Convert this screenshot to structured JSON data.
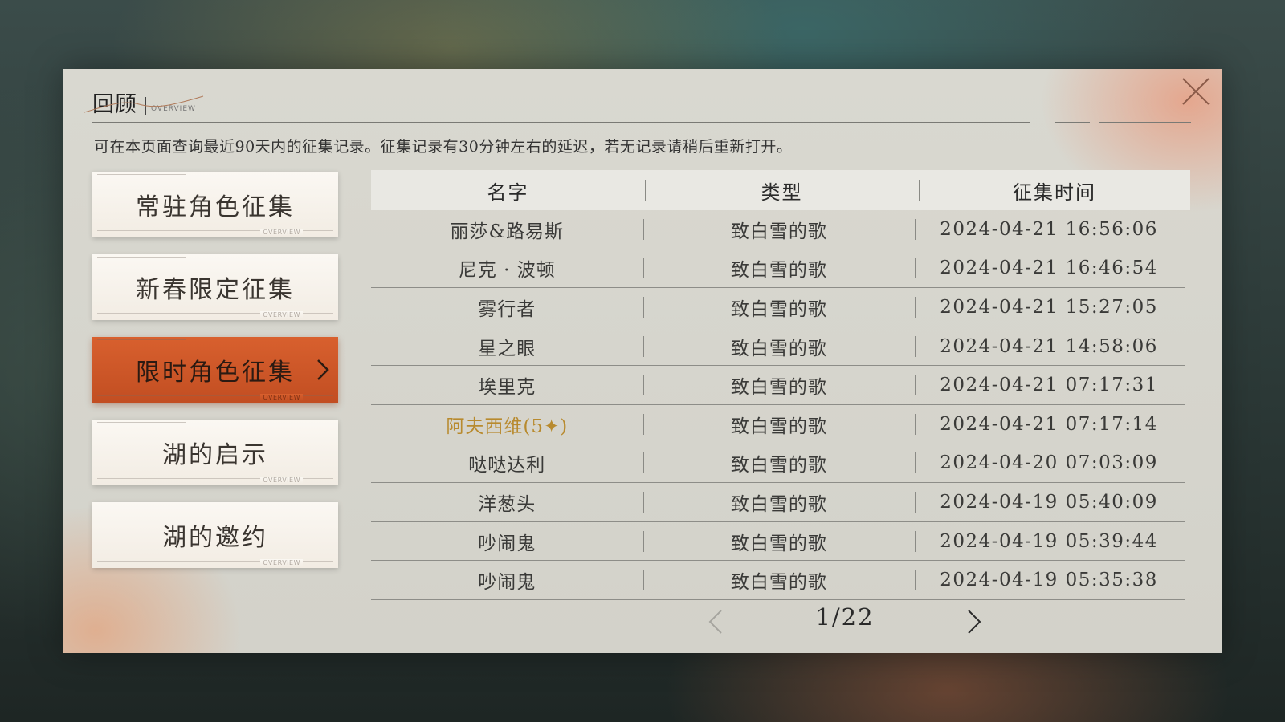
{
  "header": {
    "title": "回顾",
    "subtitle": "OVERVIEW",
    "description": "可在本页面查询最近90天内的征集记录。征集记录有30分钟左右的延迟，若无记录请稍后重新打开。"
  },
  "tabs": [
    {
      "label": "常驻角色征集",
      "active": false
    },
    {
      "label": "新春限定征集",
      "active": false
    },
    {
      "label": "限时角色征集",
      "active": true
    },
    {
      "label": "湖的启示",
      "active": false
    },
    {
      "label": "湖的邀约",
      "active": false
    }
  ],
  "tab_deco_text": "OVERVIEW",
  "table": {
    "headers": {
      "name": "名字",
      "type": "类型",
      "time": "征集时间"
    },
    "rows": [
      {
        "name": "丽莎&路易斯",
        "type": "致白雪的歌",
        "time": "2024-04-21 16:56:06",
        "highlight": false
      },
      {
        "name": "尼克 · 波顿",
        "type": "致白雪的歌",
        "time": "2024-04-21 16:46:54",
        "highlight": false
      },
      {
        "name": "雾行者",
        "type": "致白雪的歌",
        "time": "2024-04-21 15:27:05",
        "highlight": false
      },
      {
        "name": "星之眼",
        "type": "致白雪的歌",
        "time": "2024-04-21 14:58:06",
        "highlight": false
      },
      {
        "name": "埃里克",
        "type": "致白雪的歌",
        "time": "2024-04-21 07:17:31",
        "highlight": false
      },
      {
        "name": "阿夫西维(5✦)",
        "type": "致白雪的歌",
        "time": "2024-04-21 07:17:14",
        "highlight": true
      },
      {
        "name": "哒哒达利",
        "type": "致白雪的歌",
        "time": "2024-04-20 07:03:09",
        "highlight": false
      },
      {
        "name": "洋葱头",
        "type": "致白雪的歌",
        "time": "2024-04-19 05:40:09",
        "highlight": false
      },
      {
        "name": "吵闹鬼",
        "type": "致白雪的歌",
        "time": "2024-04-19 05:39:44",
        "highlight": false
      },
      {
        "name": "吵闹鬼",
        "type": "致白雪的歌",
        "time": "2024-04-19 05:35:38",
        "highlight": false
      }
    ]
  },
  "pager": {
    "text": "1/22"
  },
  "colors": {
    "accent": "#cc5626",
    "highlight": "#b88a2e"
  }
}
